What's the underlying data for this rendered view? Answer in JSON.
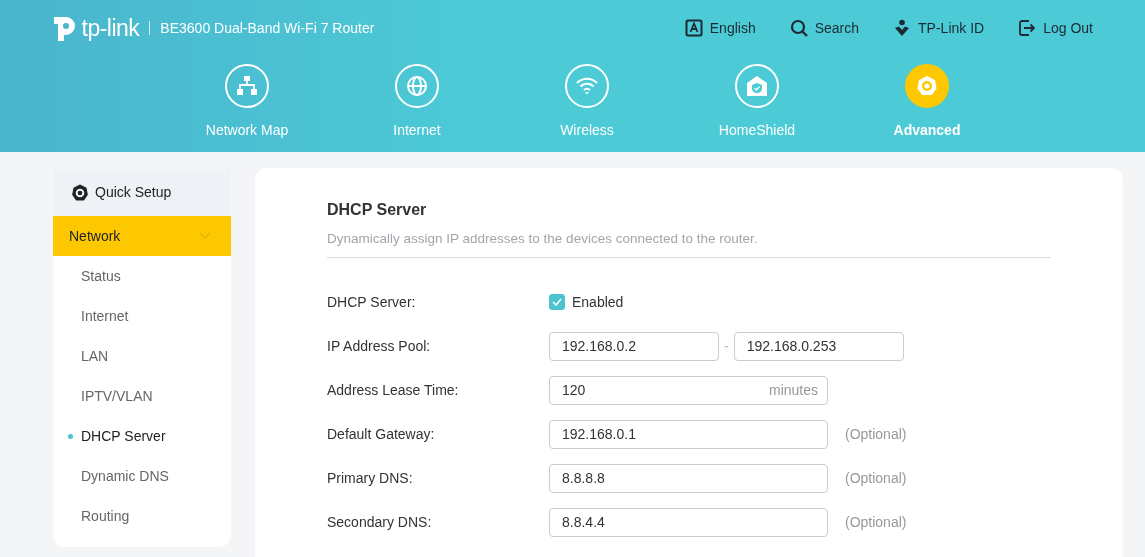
{
  "header": {
    "logo": "tp-link",
    "model": "BE3600 Dual-Band Wi-Fi 7 Router",
    "links": [
      {
        "kind": "language",
        "label": "English"
      },
      {
        "kind": "search",
        "label": "Search"
      },
      {
        "kind": "account",
        "label": "TP-Link ID"
      },
      {
        "kind": "logout",
        "label": "Log Out"
      }
    ]
  },
  "nav": [
    {
      "kind": "network-map",
      "label": "Network Map",
      "selected": false
    },
    {
      "kind": "internet",
      "label": "Internet",
      "selected": false
    },
    {
      "kind": "wireless",
      "label": "Wireless",
      "selected": false
    },
    {
      "kind": "homeshield",
      "label": "HomeShield",
      "selected": false
    },
    {
      "kind": "advanced",
      "label": "Advanced",
      "selected": true
    }
  ],
  "sidebar": {
    "quick_setup": "Quick Setup",
    "section": {
      "label": "Network",
      "expanded": true
    },
    "items": [
      {
        "label": "Status",
        "selected": false
      },
      {
        "label": "Internet",
        "selected": false
      },
      {
        "label": "LAN",
        "selected": false
      },
      {
        "label": "IPTV/VLAN",
        "selected": false
      },
      {
        "label": "DHCP Server",
        "selected": true
      },
      {
        "label": "Dynamic DNS",
        "selected": false
      },
      {
        "label": "Routing",
        "selected": false
      }
    ]
  },
  "panel": {
    "title": "DHCP Server",
    "description": "Dynamically assign IP addresses to the devices connected to the router.",
    "fields": [
      {
        "kind": "checkbox",
        "label": "DHCP Server:",
        "option": "Enabled",
        "checked": true
      },
      {
        "kind": "range",
        "label": "IP Address Pool:",
        "value_from": "192.168.0.2",
        "separator": "-",
        "value_to": "192.168.0.253"
      },
      {
        "kind": "unit",
        "label": "Address Lease Time:",
        "value": "120",
        "unit": "minutes"
      },
      {
        "kind": "text",
        "label": "Default Gateway:",
        "value": "192.168.0.1",
        "note": "(Optional)"
      },
      {
        "kind": "text",
        "label": "Primary DNS:",
        "value": "8.8.8.8",
        "note": "(Optional)"
      },
      {
        "kind": "text",
        "label": "Secondary DNS:",
        "value": "8.8.4.4",
        "note": "(Optional)"
      }
    ]
  }
}
